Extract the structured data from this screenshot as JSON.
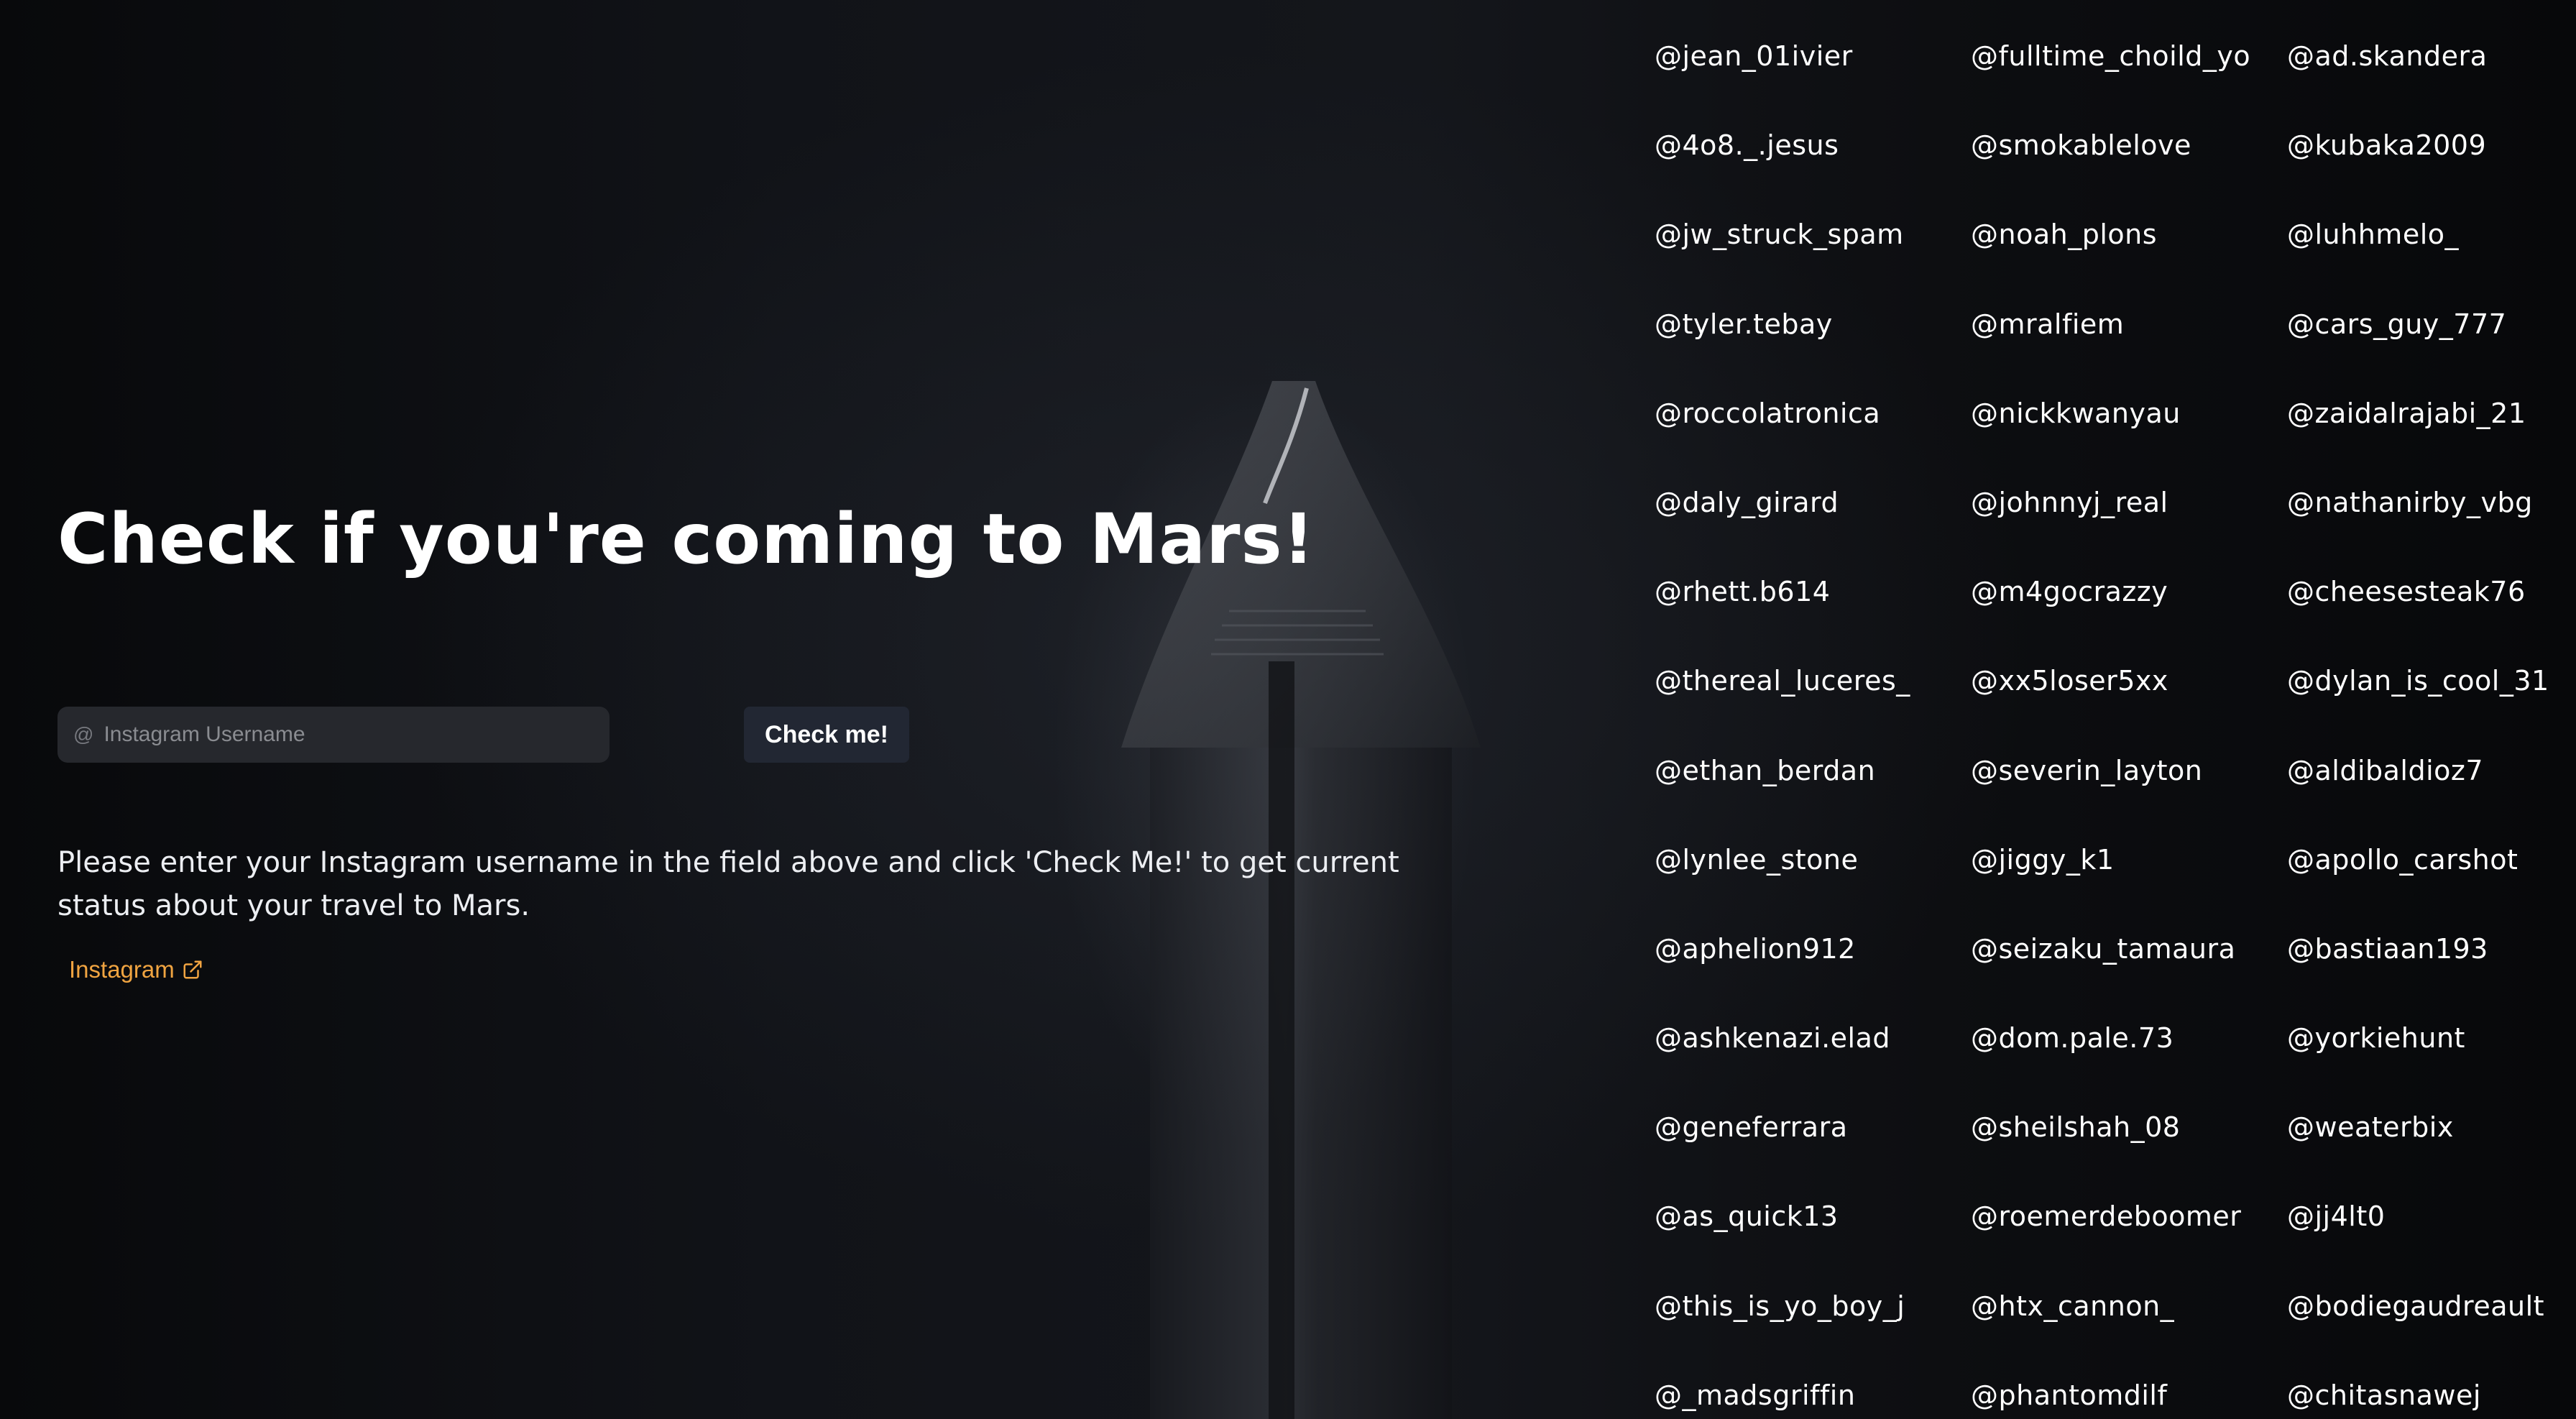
{
  "hero": {
    "title": "Check if you're coming to Mars!",
    "description": "Please enter your Instagram username in the field above and click 'Check Me!' to get current status about your travel to Mars."
  },
  "search": {
    "prefix": "@",
    "placeholder": "Instagram Username",
    "value": ""
  },
  "check_button_label": "Check me!",
  "instagram_link": {
    "label": "Instagram",
    "icon": "external-link-icon",
    "color": "#f0a441"
  },
  "users": [
    "@jean_01ivier",
    "@fulltime_choild_yo",
    "@ad.skandera",
    "@4o8._.jesus",
    "@smokablelove",
    "@kubaka2009",
    "@jw_struck_spam",
    "@noah_plons",
    "@luhhmelo_",
    "@tyler.tebay",
    "@mralfiem",
    "@cars_guy_777",
    "@roccolatronica",
    "@nickkwanyau",
    "@zaidalrajabi_21",
    "@daly_girard",
    "@johnnyj_real",
    "@nathanirby_vbg",
    "@rhett.b614",
    "@m4gocrazzy",
    "@cheesesteak76",
    "@thereal_luceres_",
    "@xx5loser5xx",
    "@dylan_is_cool_31",
    "@ethan_berdan",
    "@severin_layton",
    "@aldibaldioz7",
    "@lynlee_stone",
    "@jiggy_k1",
    "@apollo_carshot",
    "@aphelion912",
    "@seizaku_tamaura",
    "@bastiaan193",
    "@ashkenazi.elad",
    "@dom.pale.73",
    "@yorkiehunt",
    "@geneferrara",
    "@sheilshah_08",
    "@weaterbix",
    "@as_quick13",
    "@roemerdeboomer",
    "@jj4lt0",
    "@this_is_yo_boy_j",
    "@htx_cannon_",
    "@bodiegaudreault",
    "@_madsgriffin",
    "@phantomdilf",
    "@chitasnawej"
  ]
}
